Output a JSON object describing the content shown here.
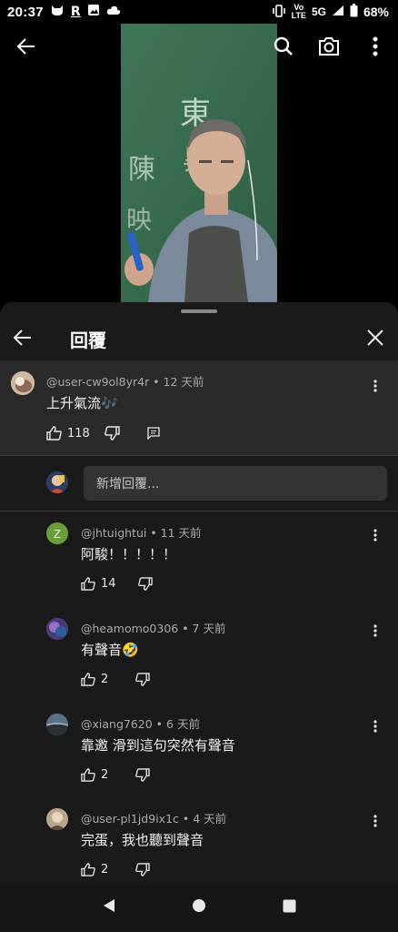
{
  "status_bar": {
    "time": "20:37",
    "left_icons": [
      "cat-icon",
      "r-icon",
      "image-icon",
      "cloud-icon"
    ],
    "r_label": "R",
    "vo_label": "Vo",
    "lte_label": "LTE",
    "network": "5G",
    "battery": "68%"
  },
  "video": {
    "toolbar": [
      "back-icon",
      "search-icon",
      "camera-icon",
      "more-icon"
    ],
    "chalk_text": "東 昇 陳 映"
  },
  "sheet": {
    "title": "回覆"
  },
  "parent_comment": {
    "meta": "@user-cw9ol8yr4r • 12 天前",
    "text": "上升氣流🎶",
    "likes": "118"
  },
  "reply_input": {
    "placeholder": "新增回覆..."
  },
  "replies": [
    {
      "meta": "@jhtuightui • 11 天前",
      "text": "阿駿！！！！！",
      "likes": "14",
      "avatar_letter": "Z",
      "avatar_color": "#689f38"
    },
    {
      "meta": "@heamomo0306 • 7 天前",
      "text": "有聲音🤣",
      "likes": "2",
      "avatar_letter": "",
      "avatar_color": "#6a4c93"
    },
    {
      "meta": "@xiang7620 • 6 天前",
      "text": "靠邀 滑到這句突然有聲音",
      "likes": "2",
      "avatar_letter": "",
      "avatar_color": "#4a5a6a"
    },
    {
      "meta": "@user-pl1jd9ix1c • 4 天前",
      "text": "完蛋，我也聽到聲音",
      "likes": "2",
      "avatar_letter": "",
      "avatar_color": "#8a7560"
    }
  ],
  "colors": {
    "sheet_bg": "#1a1a1a",
    "parent_bg": "#2a2a2a",
    "input_bg": "#333333",
    "meta_text": "#aaaaaa"
  }
}
